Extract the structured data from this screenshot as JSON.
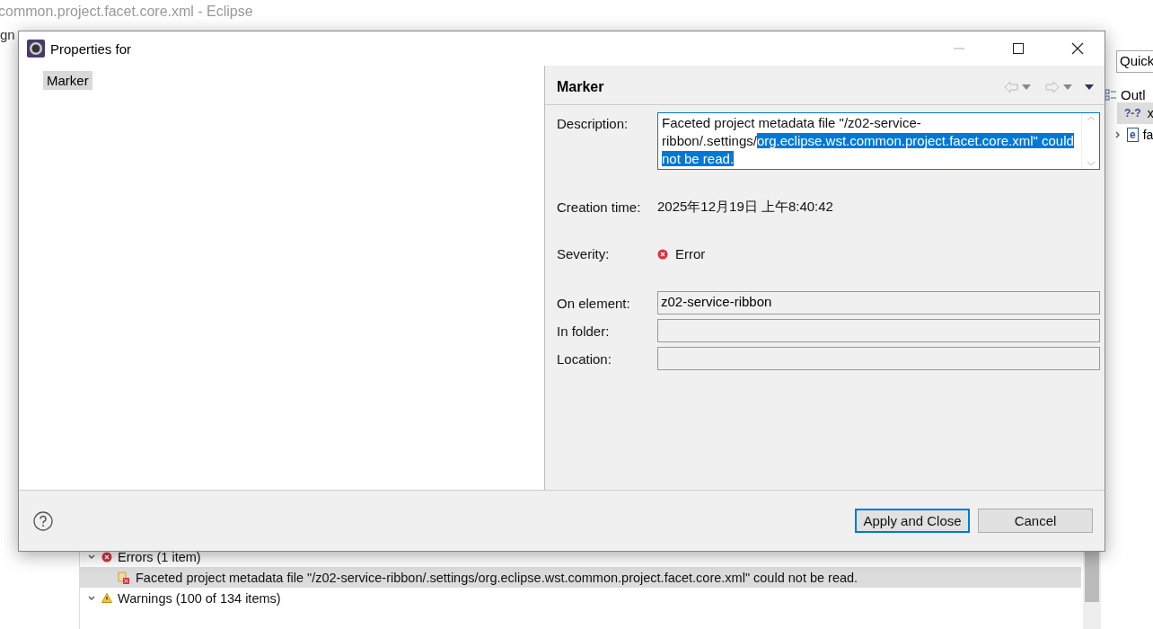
{
  "window": {
    "title": "common.project.facet.core.xml - Eclipse",
    "menu_fragment": "gn"
  },
  "quick_access": {
    "value": "Quick"
  },
  "outline": {
    "tab": "Outl",
    "items": [
      {
        "icon": "?-?",
        "label": "x",
        "selected": true,
        "expandable": false
      },
      {
        "icon": "e",
        "label": "fa",
        "selected": false,
        "expandable": true
      }
    ]
  },
  "problems": {
    "groups": [
      {
        "kind": "error",
        "label": "Errors (1 item)",
        "expanded": true,
        "items": [
          {
            "text": "Faceted project metadata file \"/z02-service-ribbon/.settings/org.eclipse.wst.common.project.facet.core.xml\" could not be read.",
            "selected": true
          }
        ]
      },
      {
        "kind": "warning",
        "label": "Warnings (100 of 134 items)",
        "expanded": true
      }
    ]
  },
  "dialog": {
    "title": "Properties for",
    "nav": [
      {
        "label": "Marker",
        "selected": true
      }
    ],
    "page_title": "Marker",
    "description": {
      "label": "Description:",
      "text": "Faceted project metadata file \"/z02-service-ribbon/.settings/",
      "selected_text": "org.eclipse.wst.common.project.facet.core.xml\" could not be read."
    },
    "creation_time": {
      "label": "Creation time:",
      "value": "2025年12月19日 上午8:40:42"
    },
    "severity": {
      "label": "Severity:",
      "kind": "error",
      "value": "Error"
    },
    "fields": [
      {
        "label": "On element:",
        "value": "z02-service-ribbon"
      },
      {
        "label": "In folder:"
      },
      {
        "label": "Location:"
      }
    ],
    "buttons": [
      {
        "label": "Apply and Close",
        "default": true
      },
      {
        "label": "Cancel",
        "default": false
      }
    ]
  }
}
